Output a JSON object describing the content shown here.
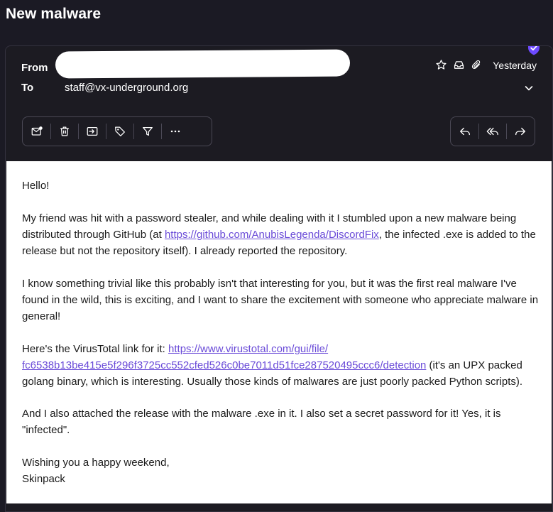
{
  "page_title": "New malware",
  "header": {
    "from_label": "From",
    "to_label": "To",
    "to_address": "staff@vx-underground.org",
    "date": "Yesterday"
  },
  "icons": {
    "verified": "shield-check-icon",
    "star": "star-icon",
    "inbox": "inbox-icon",
    "attachment": "paperclip-icon",
    "expand": "chevron-down-icon"
  },
  "toolbar_left": [
    "mark-unread-icon",
    "trash-icon",
    "move-icon",
    "label-icon",
    "filter-icon",
    "more-icon"
  ],
  "toolbar_right": [
    "reply-icon",
    "reply-all-icon",
    "forward-icon"
  ],
  "body": {
    "greeting": "Hello!",
    "p1_before": "My friend was hit with a password stealer, and while dealing with it I stumbled upon a new malware being distributed through GitHub (at ",
    "p1_link": "https://github.com/AnubisLegenda/DiscordFix",
    "p1_after": ", the infected .exe is added to the release but not the repository itself). I already reported the repository.",
    "p2": "I know something trivial like this probably isn't that interesting for you, but it was the first real malware I've found in the wild, this is exciting, and I want to share the excitement with someone who appreciate malware in general!",
    "p3_before": "Here's the VirusTotal link for it: ",
    "p3_link_line1": "https://www.virustotal.com/gui/file/",
    "p3_link_line2": "fc6538b13be415e5f296f3725cc552cfed526c0be7011d51fce287520495ccc6/detection",
    "p3_after": " (it's an UPX packed golang binary, which is interesting. Usually those kinds of malwares are just poorly packed Python scripts).",
    "p4": "And I also attached the release with the malware .exe in it. I also set a secret password for it! Yes, it is \"infected\".",
    "closing": "Wishing you a happy weekend,",
    "signature": "Skinpack"
  },
  "colors": {
    "background": "#1b1a24",
    "accent": "#6d4aff",
    "link": "#6a4bd8"
  }
}
